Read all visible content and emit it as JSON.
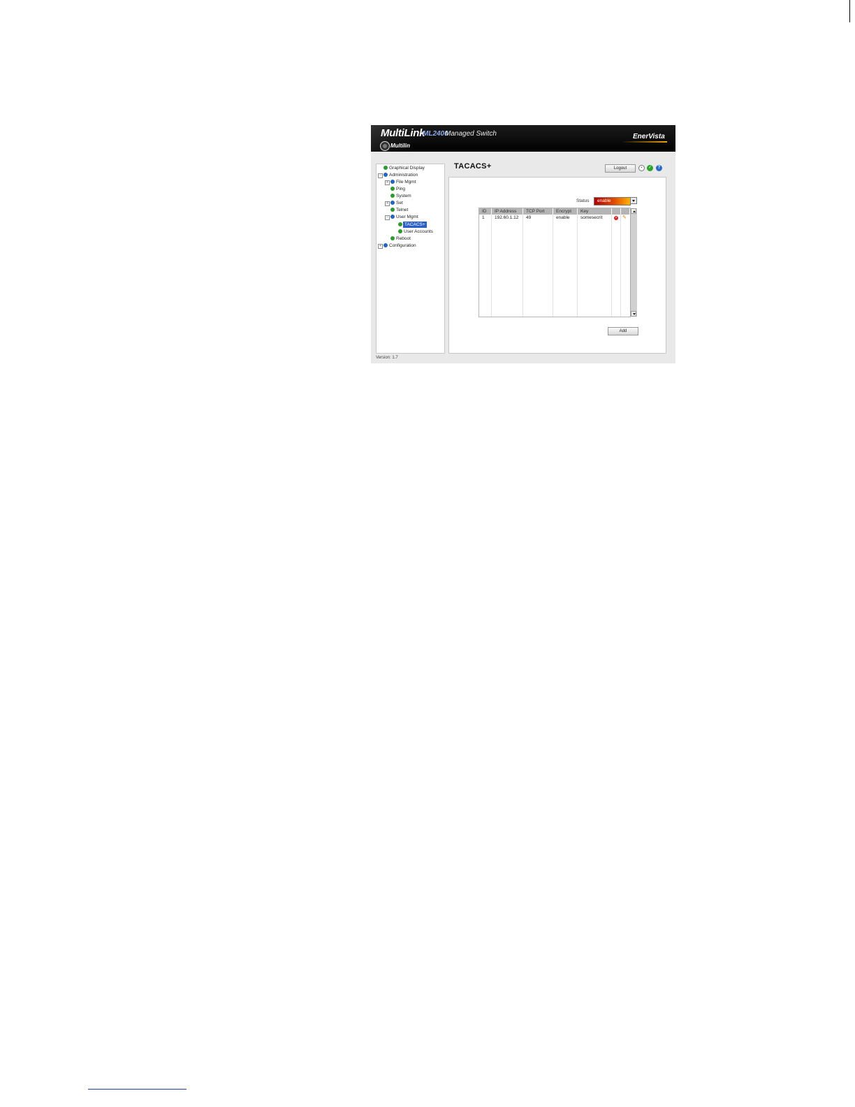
{
  "app": {
    "brand": "MultiLink",
    "model": "ML2400",
    "subtitle": "Managed Switch",
    "company": "Multilin",
    "vendor": "EnerVista",
    "version": "Version: 1.7"
  },
  "tree": {
    "items": [
      {
        "label": "Graphical Display",
        "icon": "green-bullet",
        "expander": ""
      },
      {
        "label": "Administration",
        "icon": "blue-bullet",
        "expander": "−"
      },
      {
        "label": "File Mgmt",
        "icon": "blue-bullet",
        "expander": "+"
      },
      {
        "label": "Ping",
        "icon": "green-bullet",
        "expander": ""
      },
      {
        "label": "System",
        "icon": "green-bullet",
        "expander": ""
      },
      {
        "label": "Set",
        "icon": "blue-bullet",
        "expander": "+"
      },
      {
        "label": "Telnet",
        "icon": "green-bullet",
        "expander": ""
      },
      {
        "label": "User Mgmt",
        "icon": "blue-bullet",
        "expander": "−"
      },
      {
        "label": "TACACS+",
        "icon": "green-bullet",
        "expander": "",
        "selected": true
      },
      {
        "label": "User Accounts",
        "icon": "green-bullet",
        "expander": ""
      },
      {
        "label": "Reboot",
        "icon": "green-bullet",
        "expander": ""
      },
      {
        "label": "Configuration",
        "icon": "blue-bullet",
        "expander": "+"
      }
    ]
  },
  "main": {
    "title": "TACACS+",
    "logout_label": "Logout",
    "status_label": "Status",
    "status_value": "enable",
    "add_label": "Add",
    "table": {
      "headers": [
        "ID",
        "IP Address",
        "TCP Port",
        "Encrypt",
        "Key",
        "",
        ""
      ],
      "rows": [
        [
          "1",
          "192.60.1.12",
          "49",
          "enable",
          "somesecrit"
        ]
      ]
    }
  },
  "icons": {
    "save": "save-icon",
    "apply": "check-icon",
    "help": "help-icon",
    "delete": "delete-icon",
    "edit": "edit-icon"
  },
  "colors": {
    "header_bg": "#000000",
    "selected_bg": "#2b5fc8",
    "status_start": "#b40000",
    "status_end": "#ffb200",
    "table_header": "#b5b5b5"
  }
}
